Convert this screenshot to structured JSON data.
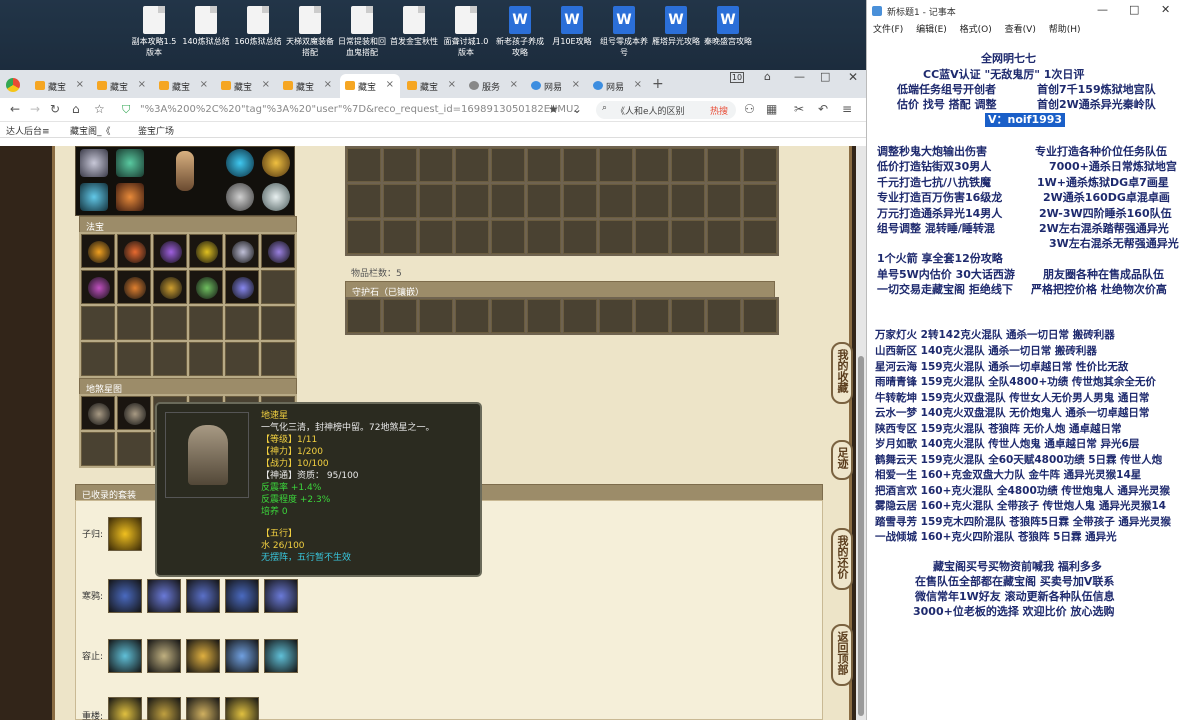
{
  "desktop": {
    "icons": [
      {
        "label": "副本攻略1.5版本",
        "type": "doc"
      },
      {
        "label": "140炼狱总结",
        "type": "doc"
      },
      {
        "label": "160炼狱总结",
        "type": "doc"
      },
      {
        "label": "天梯双魔装备搭配",
        "type": "doc"
      },
      {
        "label": "日常提装和回血鬼搭配",
        "type": "doc"
      },
      {
        "label": "首发金宝秋性",
        "type": "doc"
      },
      {
        "label": "面聋讨城1.0版本",
        "type": "doc"
      },
      {
        "label": "新老孩子养成攻略",
        "type": "word"
      },
      {
        "label": "月10E攻略",
        "type": "word"
      },
      {
        "label": "组号零成本养号",
        "type": "word"
      },
      {
        "label": "雁塔异光攻略",
        "type": "word"
      },
      {
        "label": "秦晚盛宫攻略",
        "type": "word"
      }
    ]
  },
  "browser": {
    "tabs": [
      {
        "label": "藏宝"
      },
      {
        "label": "藏宝"
      },
      {
        "label": "藏宝"
      },
      {
        "label": "藏宝"
      },
      {
        "label": "藏宝"
      },
      {
        "label": "藏宝"
      },
      {
        "label": "藏宝"
      },
      {
        "label": "服务"
      },
      {
        "label": "网易"
      },
      {
        "label": "网易"
      }
    ],
    "tab_count": "10",
    "url": "\"%3A%200%2C%20\"tag\"%3A%20\"user\"%7D&reco_request_id=1698913050182EUMU2",
    "search_text": "《人和e人的区别",
    "search_hot": "热搜",
    "bookmarks": [
      "达人后台≡",
      "藏宝阁_《",
      "鉴宝广场"
    ]
  },
  "game": {
    "sections": {
      "fabao": "法宝",
      "xingtu": "地煞星图",
      "collected": "已收录的套装",
      "guardian": "守护石（已镶嵌）",
      "item_count": "物品栏数：5"
    },
    "rows": [
      "子归:",
      "寒鸦:",
      "容止:",
      "重楼:"
    ],
    "tooltip": {
      "name": "地速星",
      "desc": "一气化三清，封神榜中留。72地煞星之一。",
      "level": "【等级】1/11",
      "shenli": "【神力】1/200",
      "zhanli": "【战力】10/100",
      "shentong": "【神通】资质：  95/100",
      "fanshenlv": "反震率 +1.4%",
      "fanshenchengdu": "反震程度 +2.3%",
      "peiyang": "培养 0",
      "wuxing_title": "【五行】",
      "wuxing_value": "水 26/100",
      "wuxing_note": "无摆阵，五行暂不生效"
    },
    "side_buttons": [
      "我的收藏",
      "足迹",
      "我的还价",
      "返回顶部"
    ],
    "colors": {
      "accent": "#9c8c69",
      "tooltip_yellow": "#f2d040",
      "tooltip_green": "#3bd63b",
      "tooltip_cyan": "#39c9e0"
    }
  },
  "notepad": {
    "title": "新标题1 - 记事本",
    "menu": [
      "文件(F)",
      "编辑(E)",
      "格式(O)",
      "查看(V)",
      "帮助(H)"
    ],
    "lines": [
      "全网明七七",
      "CC蓝V认证 \"无敌鬼厉\" 1次日评",
      "低端任务组号开创者",
      "首创7千159炼狱地宫队",
      "估价 找号 搭配 调整",
      "首创2W通杀异光秦岭队",
      "V：noif1993",
      "调整秒鬼大炮输出伤害",
      "专业打造各种价位任务队伍",
      "低价打造钻街双30男人",
      "7000+通杀日常炼狱地宫",
      "千元打造七抗/八抗铁魔",
      "1W+通杀炼狱DG卓7画星",
      "专业打造百万伤害16级龙",
      "2W通杀160DG卓混卓画",
      "万元打造通杀异光14男人",
      "2W-3W四阶睡杀160队伍",
      "组号调整 混转睡/睡转混",
      "2W左右混杀踏帮强通异光",
      "3W左右混杀无帮强通异光",
      "1个火箭 享全套12份攻略",
      "单号5W内估价 30大话西游",
      "朋友圈各种在售成品队伍",
      "一切交易走藏宝阁 拒绝线下",
      "严格把控价格 杜绝物次价高",
      "万家灯火 2转142克火混队 通杀一切日常 搬砖利器",
      "山西新区 140克火混队 通杀一切日常 搬砖利器",
      "星河云海 159克火混队 通杀一切卓越日常 性价比无敌",
      "雨晴青锋 159克火混队 全队4800+功绩 传世炮其余全无价",
      "牛转乾坤 159克火双盘混队 传世女人无价男人男鬼 通日常",
      "云水一梦 140克火双盘混队 无价炮鬼人 通杀一切卓越日常",
      "陕西专区 159克火混队 苍狼阵 无价人炮 通卓越日常",
      "岁月如歌 140克火混队 传世人炮鬼 通卓越日常 异光6层",
      "鹤舞云天 159克火混队 全60天赋4800功绩 5日霖 传世人炮",
      "相爱一生 160+克金双盘大力队 金牛阵 通异光灵猴14星",
      "把酒言欢 160+克火混队 全4800功绩 传世炮鬼人 通异光灵猴",
      "雾隐云居 160+克火混队 全带孩子 传世炮人鬼 通异光灵猴14",
      "踏雪寻芳 159克木四阶混队 苍狼阵5日霖 全带孩子 通异光灵猴",
      "一战倾城 160+克火四阶混队 苍狼阵 5日霖 通异光",
      "藏宝阁买号买物资前喊我 福利多多",
      "在售队伍全部都在藏宝阁 买卖号加V联系",
      "微信常年1W好友 滚动更新各种队伍信息",
      "3000+位老板的选择 欢迎比价 放心选购"
    ]
  }
}
